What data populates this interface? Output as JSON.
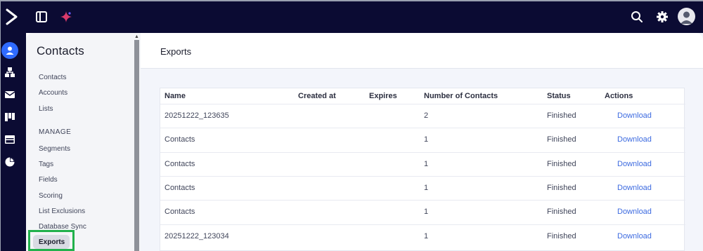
{
  "topbar": {
    "icons": [
      "logo-icon",
      "panel-toggle-icon",
      "sparkle-icon",
      "search-icon",
      "gear-icon",
      "user-avatar-icon"
    ]
  },
  "rail": {
    "icons": [
      "contacts-icon",
      "org-chart-icon",
      "mail-icon",
      "board-icon",
      "browser-icon",
      "pie-chart-icon"
    ]
  },
  "sidebar": {
    "title": "Contacts",
    "items": [
      "Contacts",
      "Accounts",
      "Lists"
    ],
    "section": "MANAGE",
    "manage_items": [
      "Segments",
      "Tags",
      "Fields",
      "Scoring",
      "List Exclusions",
      "Database Sync",
      "Exports"
    ],
    "active": "Exports"
  },
  "main": {
    "title": "Exports",
    "columns": [
      "Name",
      "Created at",
      "Expires",
      "Number of Contacts",
      "Status",
      "Actions"
    ],
    "rows": [
      {
        "name": "20251222_123635",
        "created": "",
        "expires": "",
        "count": "2",
        "status": "Finished",
        "action": "Download"
      },
      {
        "name": "Contacts",
        "created": "",
        "expires": "",
        "count": "1",
        "status": "Finished",
        "action": "Download"
      },
      {
        "name": "Contacts",
        "created": "",
        "expires": "",
        "count": "1",
        "status": "Finished",
        "action": "Download"
      },
      {
        "name": "Contacts",
        "created": "",
        "expires": "",
        "count": "1",
        "status": "Finished",
        "action": "Download"
      },
      {
        "name": "Contacts",
        "created": "",
        "expires": "",
        "count": "1",
        "status": "Finished",
        "action": "Download"
      },
      {
        "name": "20251222_123034",
        "created": "",
        "expires": "",
        "count": "1",
        "status": "Finished",
        "action": "Download"
      }
    ]
  },
  "colors": {
    "nav_bg": "#0b0b33",
    "accent": "#2f6bff",
    "link": "#3d6be0",
    "highlight": "#22b14c"
  }
}
